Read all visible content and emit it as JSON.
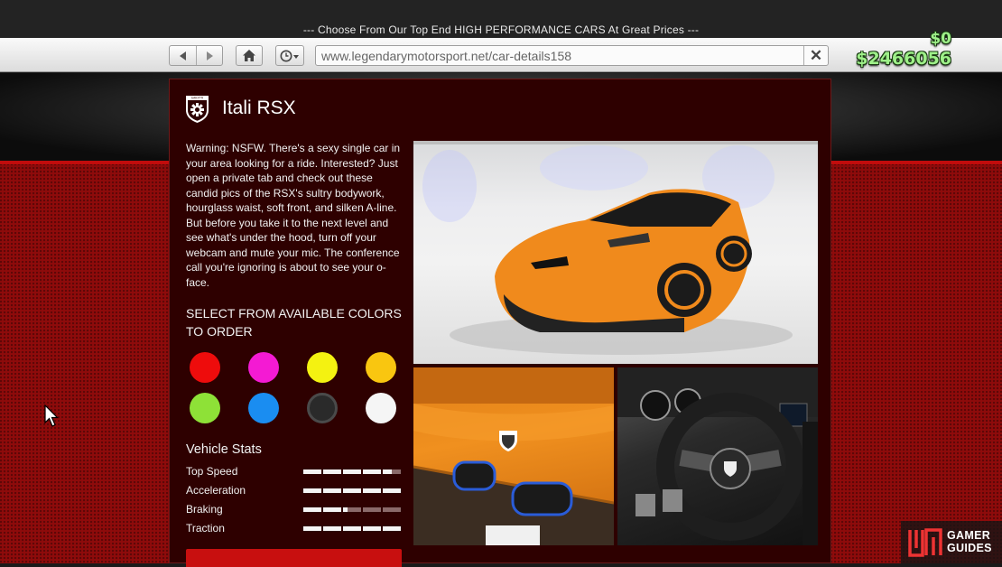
{
  "banner": {
    "ticker": "--- Choose From Our Top End HIGH PERFORMANCE CARS At Great Prices ---"
  },
  "browser": {
    "back_icon": "back-arrow-icon",
    "forward_icon": "forward-arrow-icon",
    "home_icon": "home-icon",
    "history_icon": "clock-icon",
    "url": "www.legendarymotorsport.net/car-details158",
    "close_icon": "close-icon"
  },
  "hud": {
    "cash": "$0",
    "bank": "$2466056",
    "money_color": "#9ef089"
  },
  "car": {
    "name": "Itali RSX",
    "brand_logo": "grotti-shield-logo",
    "brand_logo_text": "GROTTI",
    "description": "Warning: NSFW. There's a sexy single car in your area looking for a ride. Interested? Just open a private tab and check out these candid pics of the RSX's sultry bodywork, hourglass waist, soft front, and silken A-line. But before you take it to the next level and see what's under the hood, turn off your webcam and mute your mic. The conference call you're ignoring is about to see your o-face."
  },
  "colors": {
    "heading": "SELECT FROM AVAILABLE COLORS TO ORDER",
    "swatches": [
      {
        "name": "red",
        "hex": "#ee0c0c"
      },
      {
        "name": "magenta",
        "hex": "#f41ad3"
      },
      {
        "name": "yellow",
        "hex": "#f4f211"
      },
      {
        "name": "gold",
        "hex": "#f9c610"
      },
      {
        "name": "lime",
        "hex": "#8ee137"
      },
      {
        "name": "blue",
        "hex": "#1a8df1"
      },
      {
        "name": "black",
        "hex": "#2a2a2a",
        "selected": true
      },
      {
        "name": "white",
        "hex": "#f5f5f5"
      }
    ]
  },
  "stats": {
    "heading": "Vehicle Stats",
    "items": [
      {
        "label": "Top Speed",
        "value": 0.9
      },
      {
        "label": "Acceleration",
        "value": 1.0
      },
      {
        "label": "Braking",
        "value": 0.45
      },
      {
        "label": "Traction",
        "value": 1.0
      }
    ]
  },
  "photos": {
    "main": "car-front-three-quarter-photo",
    "rear": "car-rear-badge-photo",
    "interior": "steering-wheel-interior-photo"
  },
  "watermark": {
    "line1": "GAMER",
    "line2": "GUIDES"
  }
}
